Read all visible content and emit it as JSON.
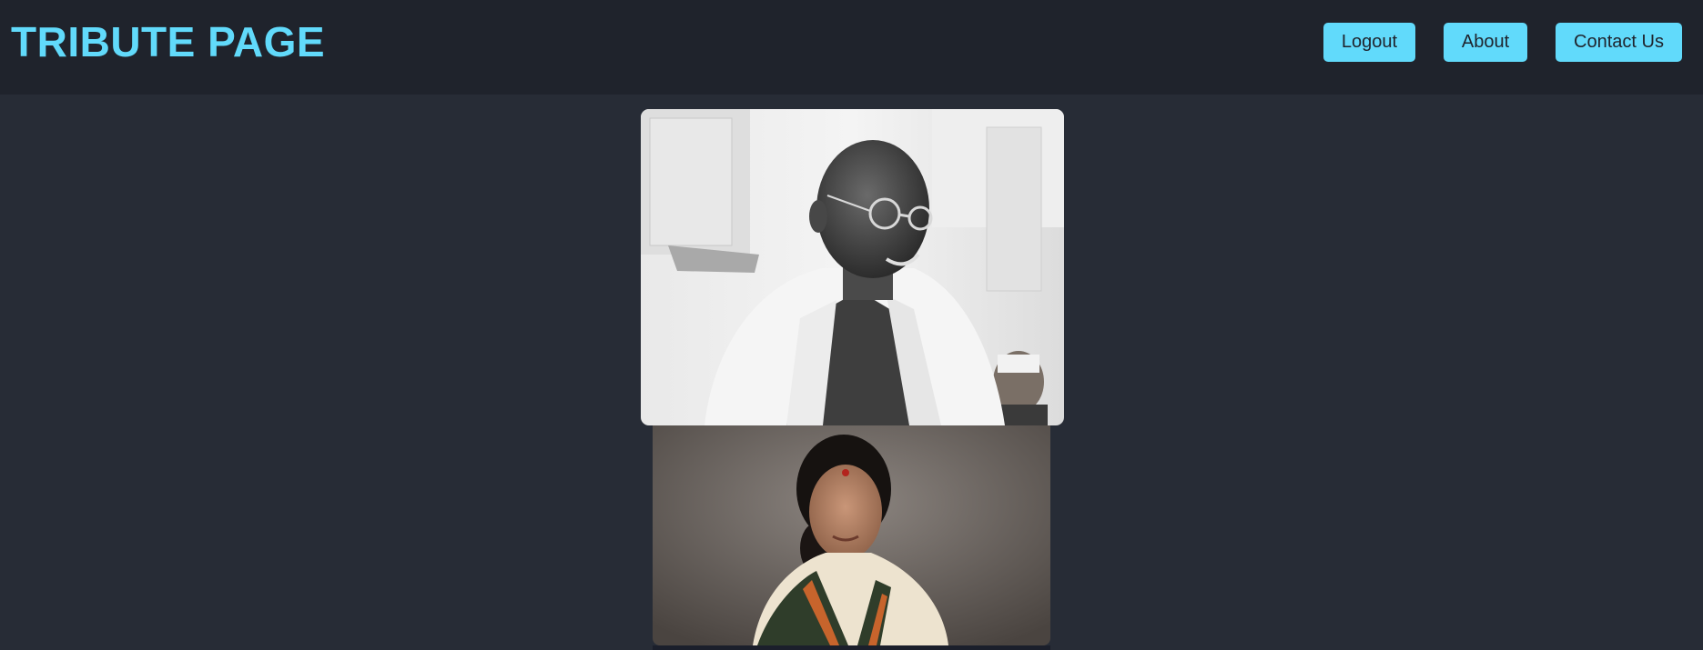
{
  "header": {
    "title": "TRIBUTE PAGE"
  },
  "nav": {
    "logout_label": "Logout",
    "about_label": "About",
    "contact_label": "Contact Us"
  },
  "colors": {
    "accent": "#61dafb",
    "header_bg": "#1f232c",
    "page_bg": "#272c36"
  },
  "gallery": {
    "photos": [
      {
        "subject": "black-and-white portrait of a smiling elderly man with round glasses and white shawl"
      },
      {
        "subject": "color portrait of an elderly woman with a red bindi wearing a cream and green sari"
      }
    ]
  }
}
